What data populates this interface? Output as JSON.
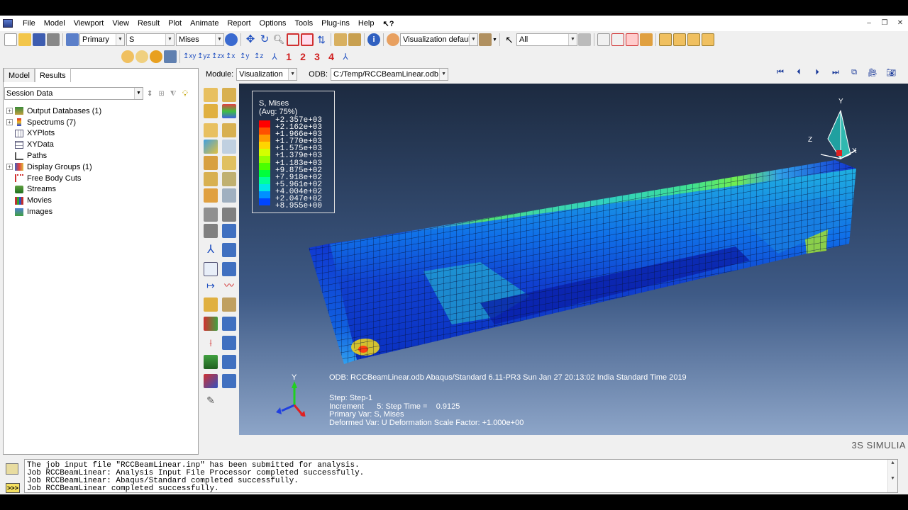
{
  "menu": {
    "items": [
      "File",
      "Model",
      "Viewport",
      "View",
      "Result",
      "Plot",
      "Animate",
      "Report",
      "Options",
      "Tools",
      "Plug-ins",
      "Help"
    ],
    "help_symbol": "⁇"
  },
  "toolbar": {
    "primary": "Primary",
    "field_var": "S",
    "invariant": "Mises",
    "visualization_defaults": "Visualization defaults",
    "selection": "All",
    "nums": [
      "1",
      "2",
      "3",
      "4"
    ]
  },
  "module_row": {
    "module_label": "Module:",
    "module_value": "Visualization",
    "odb_label": "ODB:",
    "odb_value": "C:/Temp/RCCBeamLinear.odb"
  },
  "left_panel": {
    "tabs": [
      "Model",
      "Results"
    ],
    "session": "Session Data",
    "tree": [
      {
        "label": "Output Databases (1)",
        "expandable": true
      },
      {
        "label": "Spectrums (7)",
        "expandable": true
      },
      {
        "label": "XYPlots",
        "expandable": false
      },
      {
        "label": "XYData",
        "expandable": false
      },
      {
        "label": "Paths",
        "expandable": false
      },
      {
        "label": "Display Groups (1)",
        "expandable": true
      },
      {
        "label": "Free Body Cuts",
        "expandable": false
      },
      {
        "label": "Streams",
        "expandable": false
      },
      {
        "label": "Movies",
        "expandable": false
      },
      {
        "label": "Images",
        "expandable": false
      }
    ]
  },
  "legend": {
    "title1": "S, Mises",
    "title2": "(Avg: 75%)",
    "values": [
      "+2.357e+03",
      "+2.162e+03",
      "+1.966e+03",
      "+1.770e+03",
      "+1.575e+03",
      "+1.379e+03",
      "+1.183e+03",
      "+9.875e+02",
      "+7.918e+02",
      "+5.961e+02",
      "+4.004e+02",
      "+2.047e+02",
      "+8.955e+00"
    ],
    "colors": [
      "#ff0000",
      "#ff5000",
      "#ff9a00",
      "#ffd400",
      "#d4ff00",
      "#96ff00",
      "#4aff00",
      "#00ff3c",
      "#00ff9a",
      "#00e6e6",
      "#0090ff",
      "#0045ff",
      "#0000e0"
    ]
  },
  "info": {
    "odb_line": "ODB: RCCBeamLinear.odb    Abaqus/Standard 6.11-PR3    Sun Jan 27 20:13:02 India Standard Time 2019",
    "step": "Step: Step-1",
    "increment": "Increment      5: Step Time =    0.9125",
    "primary": "Primary Var: S, Mises",
    "deformed": "Deformed Var: U   Deformation Scale Factor: +1.000e+00"
  },
  "triad_labels": {
    "y": "Y",
    "z": "Z",
    "x": "X"
  },
  "brand": "3S SIMULIA",
  "messages": [
    "The job input file \"RCCBeamLinear.inp\" has been submitted for analysis.",
    "Job RCCBeamLinear: Analysis Input File Processor completed successfully.",
    "Job RCCBeamLinear: Abaqus/Standard completed successfully.",
    "Job RCCBeamLinear completed successfully."
  ],
  "cmd_prompt": ">>>"
}
